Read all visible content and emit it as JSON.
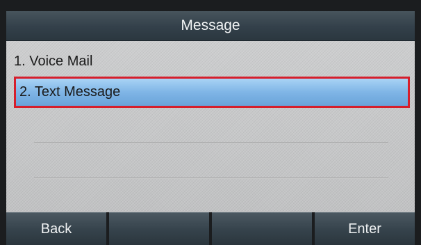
{
  "title_bar": {
    "title": "Message"
  },
  "menu": {
    "items": [
      {
        "label": "1. Voice Mail"
      },
      {
        "label": "2. Text Message",
        "selected": true
      }
    ]
  },
  "softkeys": [
    {
      "label": "Back"
    },
    {
      "label": ""
    },
    {
      "label": ""
    },
    {
      "label": "Enter"
    }
  ],
  "colors": {
    "selection_highlight": "#7fb5e6",
    "selection_border": "#d61e2b",
    "title_bar": "#33404a",
    "softkey": "#35424b",
    "screen_background": "#c9cacb"
  }
}
